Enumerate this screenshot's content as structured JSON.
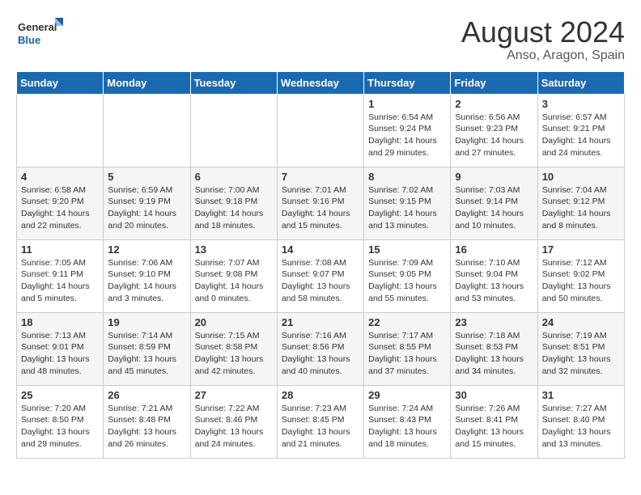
{
  "logo": {
    "general": "General",
    "blue": "Blue"
  },
  "title": "August 2024",
  "subtitle": "Anso, Aragon, Spain",
  "days_of_week": [
    "Sunday",
    "Monday",
    "Tuesday",
    "Wednesday",
    "Thursday",
    "Friday",
    "Saturday"
  ],
  "weeks": [
    [
      {
        "day": "",
        "info": ""
      },
      {
        "day": "",
        "info": ""
      },
      {
        "day": "",
        "info": ""
      },
      {
        "day": "",
        "info": ""
      },
      {
        "day": "1",
        "info": "Sunrise: 6:54 AM\nSunset: 9:24 PM\nDaylight: 14 hours\nand 29 minutes."
      },
      {
        "day": "2",
        "info": "Sunrise: 6:56 AM\nSunset: 9:23 PM\nDaylight: 14 hours\nand 27 minutes."
      },
      {
        "day": "3",
        "info": "Sunrise: 6:57 AM\nSunset: 9:21 PM\nDaylight: 14 hours\nand 24 minutes."
      }
    ],
    [
      {
        "day": "4",
        "info": "Sunrise: 6:58 AM\nSunset: 9:20 PM\nDaylight: 14 hours\nand 22 minutes."
      },
      {
        "day": "5",
        "info": "Sunrise: 6:59 AM\nSunset: 9:19 PM\nDaylight: 14 hours\nand 20 minutes."
      },
      {
        "day": "6",
        "info": "Sunrise: 7:00 AM\nSunset: 9:18 PM\nDaylight: 14 hours\nand 18 minutes."
      },
      {
        "day": "7",
        "info": "Sunrise: 7:01 AM\nSunset: 9:16 PM\nDaylight: 14 hours\nand 15 minutes."
      },
      {
        "day": "8",
        "info": "Sunrise: 7:02 AM\nSunset: 9:15 PM\nDaylight: 14 hours\nand 13 minutes."
      },
      {
        "day": "9",
        "info": "Sunrise: 7:03 AM\nSunset: 9:14 PM\nDaylight: 14 hours\nand 10 minutes."
      },
      {
        "day": "10",
        "info": "Sunrise: 7:04 AM\nSunset: 9:12 PM\nDaylight: 14 hours\nand 8 minutes."
      }
    ],
    [
      {
        "day": "11",
        "info": "Sunrise: 7:05 AM\nSunset: 9:11 PM\nDaylight: 14 hours\nand 5 minutes."
      },
      {
        "day": "12",
        "info": "Sunrise: 7:06 AM\nSunset: 9:10 PM\nDaylight: 14 hours\nand 3 minutes."
      },
      {
        "day": "13",
        "info": "Sunrise: 7:07 AM\nSunset: 9:08 PM\nDaylight: 14 hours\nand 0 minutes."
      },
      {
        "day": "14",
        "info": "Sunrise: 7:08 AM\nSunset: 9:07 PM\nDaylight: 13 hours\nand 58 minutes."
      },
      {
        "day": "15",
        "info": "Sunrise: 7:09 AM\nSunset: 9:05 PM\nDaylight: 13 hours\nand 55 minutes."
      },
      {
        "day": "16",
        "info": "Sunrise: 7:10 AM\nSunset: 9:04 PM\nDaylight: 13 hours\nand 53 minutes."
      },
      {
        "day": "17",
        "info": "Sunrise: 7:12 AM\nSunset: 9:02 PM\nDaylight: 13 hours\nand 50 minutes."
      }
    ],
    [
      {
        "day": "18",
        "info": "Sunrise: 7:13 AM\nSunset: 9:01 PM\nDaylight: 13 hours\nand 48 minutes."
      },
      {
        "day": "19",
        "info": "Sunrise: 7:14 AM\nSunset: 8:59 PM\nDaylight: 13 hours\nand 45 minutes."
      },
      {
        "day": "20",
        "info": "Sunrise: 7:15 AM\nSunset: 8:58 PM\nDaylight: 13 hours\nand 42 minutes."
      },
      {
        "day": "21",
        "info": "Sunrise: 7:16 AM\nSunset: 8:56 PM\nDaylight: 13 hours\nand 40 minutes."
      },
      {
        "day": "22",
        "info": "Sunrise: 7:17 AM\nSunset: 8:55 PM\nDaylight: 13 hours\nand 37 minutes."
      },
      {
        "day": "23",
        "info": "Sunrise: 7:18 AM\nSunset: 8:53 PM\nDaylight: 13 hours\nand 34 minutes."
      },
      {
        "day": "24",
        "info": "Sunrise: 7:19 AM\nSunset: 8:51 PM\nDaylight: 13 hours\nand 32 minutes."
      }
    ],
    [
      {
        "day": "25",
        "info": "Sunrise: 7:20 AM\nSunset: 8:50 PM\nDaylight: 13 hours\nand 29 minutes."
      },
      {
        "day": "26",
        "info": "Sunrise: 7:21 AM\nSunset: 8:48 PM\nDaylight: 13 hours\nand 26 minutes."
      },
      {
        "day": "27",
        "info": "Sunrise: 7:22 AM\nSunset: 8:46 PM\nDaylight: 13 hours\nand 24 minutes."
      },
      {
        "day": "28",
        "info": "Sunrise: 7:23 AM\nSunset: 8:45 PM\nDaylight: 13 hours\nand 21 minutes."
      },
      {
        "day": "29",
        "info": "Sunrise: 7:24 AM\nSunset: 8:43 PM\nDaylight: 13 hours\nand 18 minutes."
      },
      {
        "day": "30",
        "info": "Sunrise: 7:26 AM\nSunset: 8:41 PM\nDaylight: 13 hours\nand 15 minutes."
      },
      {
        "day": "31",
        "info": "Sunrise: 7:27 AM\nSunset: 8:40 PM\nDaylight: 13 hours\nand 13 minutes."
      }
    ]
  ]
}
